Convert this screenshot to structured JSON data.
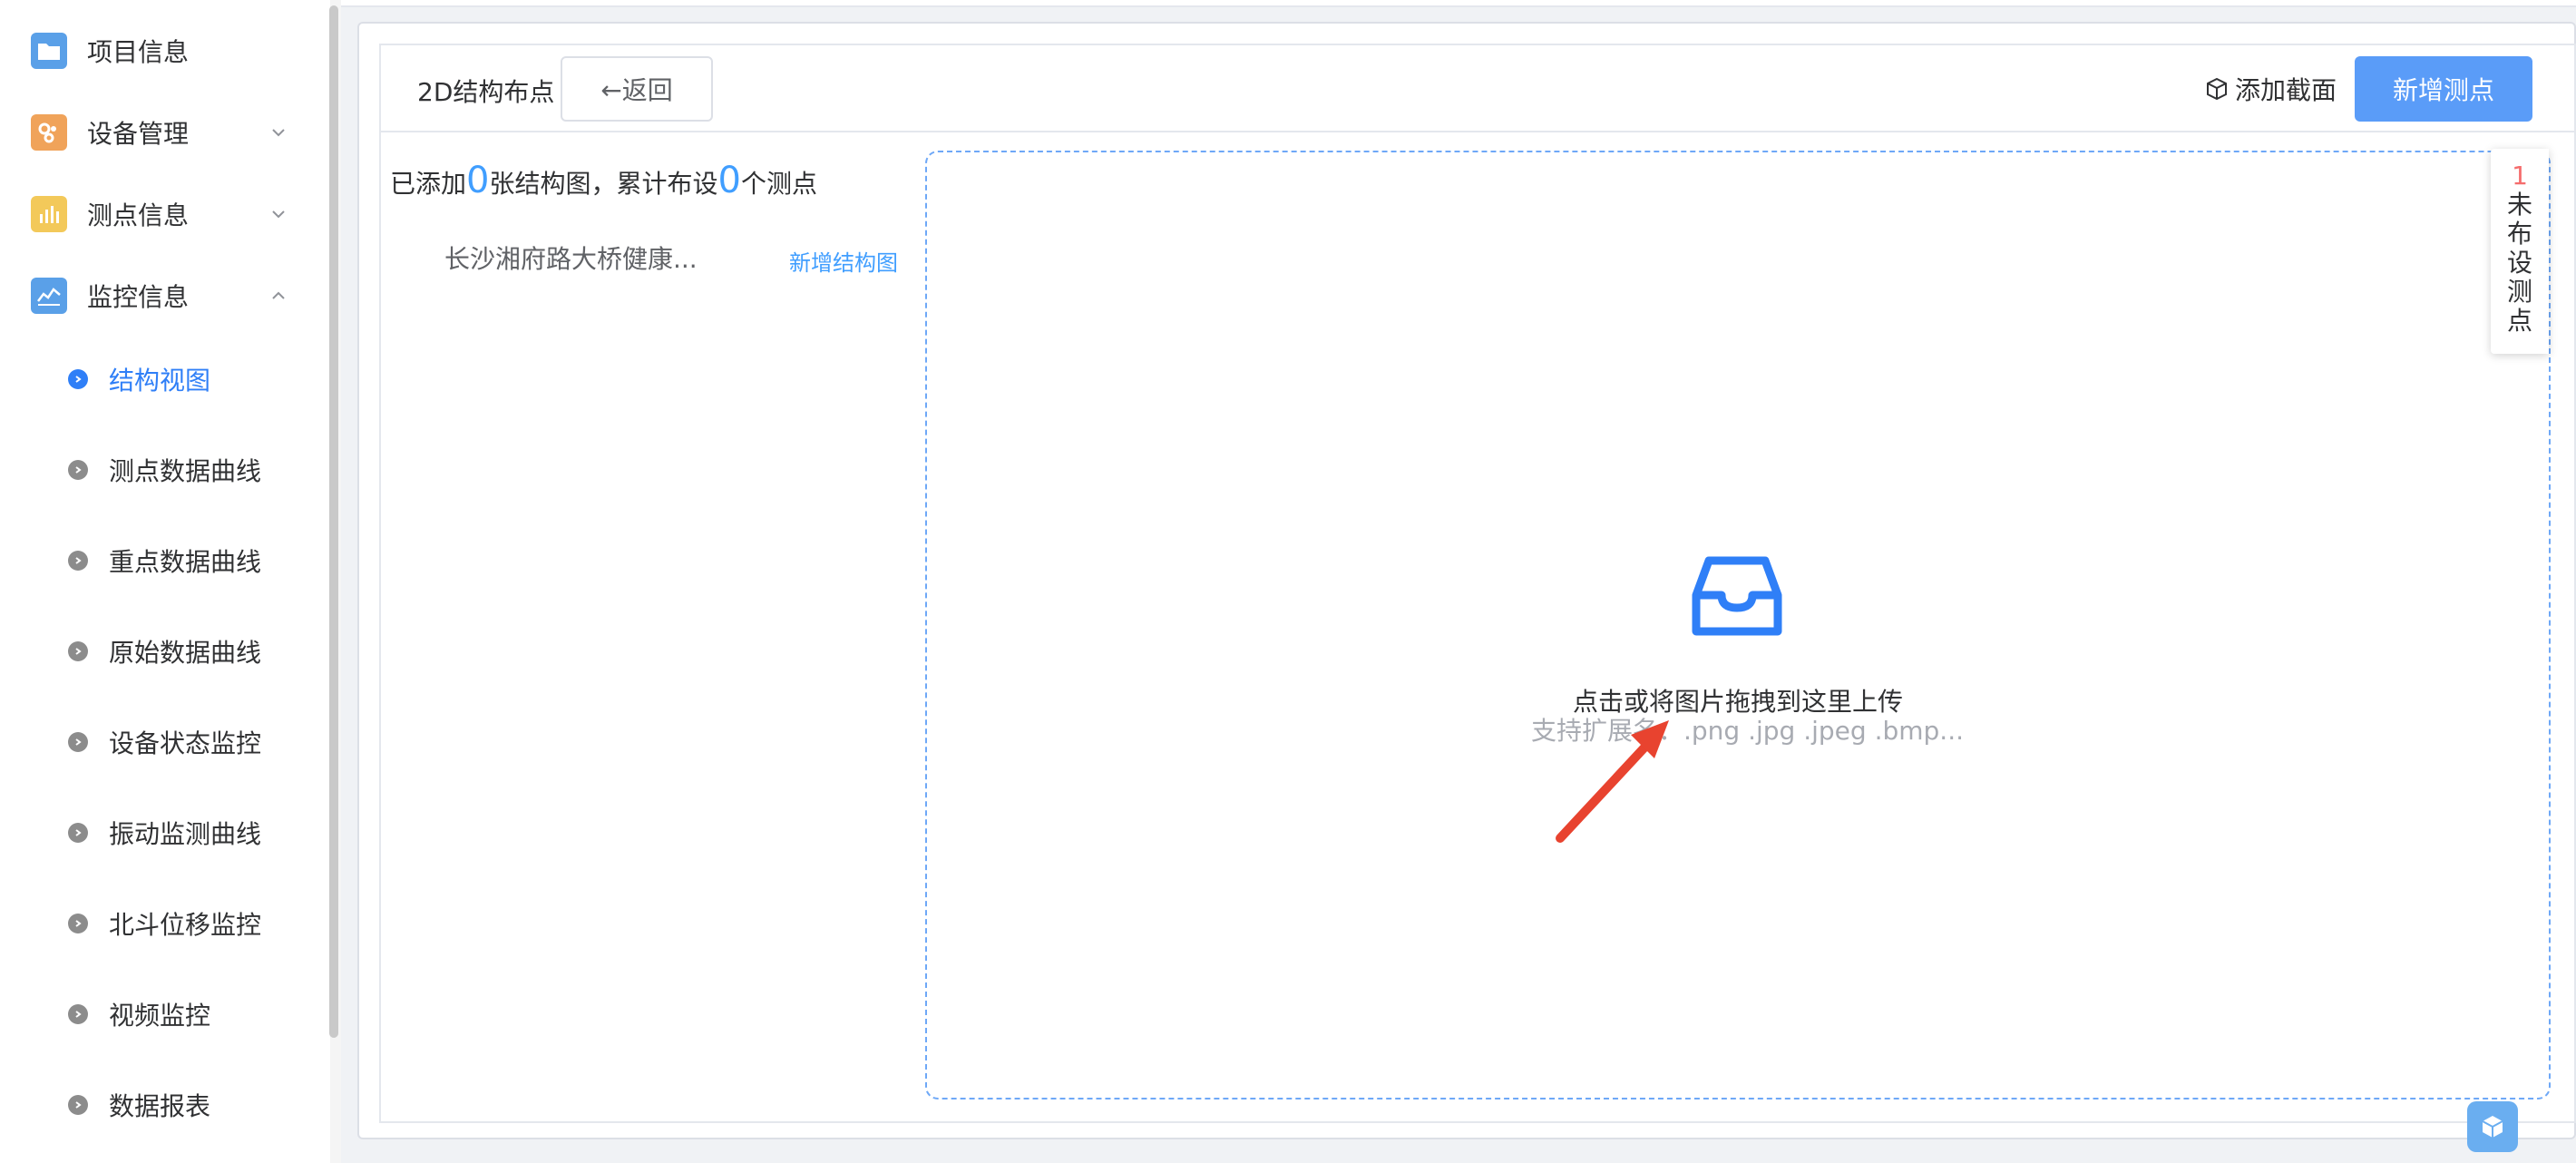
{
  "sidebar": {
    "menus": [
      {
        "label": "项目信息",
        "icon": "folder-icon",
        "color": "#5aa0e8",
        "arrow": "none"
      },
      {
        "label": "设备管理",
        "icon": "devices-icon",
        "color": "#f0a35a",
        "arrow": "down"
      },
      {
        "label": "测点信息",
        "icon": "bar-chart-icon",
        "color": "#f3c95a",
        "arrow": "down"
      },
      {
        "label": "监控信息",
        "icon": "line-chart-icon",
        "color": "#5aa0e8",
        "arrow": "up"
      }
    ],
    "submenu": [
      {
        "label": "结构视图",
        "active": true
      },
      {
        "label": "测点数据曲线",
        "active": false
      },
      {
        "label": "重点数据曲线",
        "active": false
      },
      {
        "label": "原始数据曲线",
        "active": false
      },
      {
        "label": "设备状态监控",
        "active": false
      },
      {
        "label": "振动监测曲线",
        "active": false
      },
      {
        "label": "北斗位移监控",
        "active": false
      },
      {
        "label": "视频监控",
        "active": false
      },
      {
        "label": "数据报表",
        "active": false
      }
    ]
  },
  "header": {
    "title": "2D结构布点",
    "back_label": "←返回",
    "add_section_label": "添加截面",
    "add_point_label": "新增测点"
  },
  "summary": {
    "prefix": "已添加",
    "structure_count": "0",
    "middle": "张结构图，累计布设",
    "point_count": "0",
    "suffix": "个测点"
  },
  "structure": {
    "name": "长沙湘府路大桥健康...",
    "add_link": "新增结构图"
  },
  "upload": {
    "text": "点击或将图片拖拽到这里上传",
    "hint": "支持扩展名：.png .jpg .jpeg .bmp..."
  },
  "side_tab": {
    "count": "1",
    "label": "未布设测点"
  },
  "colors": {
    "primary": "#409eff",
    "button": "#5a9cf8",
    "danger": "#f56c6c",
    "annotation_arrow": "#e8432f"
  }
}
